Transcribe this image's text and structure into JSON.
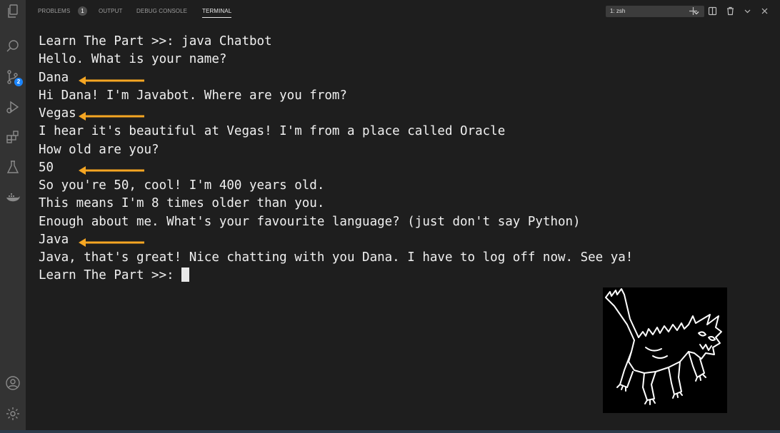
{
  "panel": {
    "tabs": [
      {
        "label": "PROBLEMS",
        "badge": "1"
      },
      {
        "label": "OUTPUT"
      },
      {
        "label": "DEBUG CONSOLE"
      },
      {
        "label": "TERMINAL",
        "active": true
      }
    ],
    "terminal_selector": "1: zsh"
  },
  "activity_bar": {
    "source_control_badge": "2",
    "icons": [
      "explorer-icon",
      "search-icon",
      "source-control-icon",
      "run-debug-icon",
      "extensions-icon",
      "testing-icon",
      "docker-icon",
      "account-icon",
      "settings-gear-icon"
    ]
  },
  "terminal": {
    "lines": [
      "Learn The Part >>: java Chatbot",
      "Hello. What is your name?",
      "Dana",
      "Hi Dana! I'm Javabot. Where are you from?",
      "Vegas",
      "I hear it's beautiful at Vegas! I'm from a place called Oracle",
      "How old are you?",
      "50",
      "So you're 50, cool! I'm 400 years old.",
      "This means I'm 8 times older than you.",
      "Enough about me. What's your favourite language? (just don't say Python)",
      "Java",
      "Java, that's great! Nice chatting with you Dana. I have to log off now. See ya!",
      "Learn The Part >>: "
    ]
  },
  "colors": {
    "arrow": "#f5a623",
    "terminal_bg": "#1e1e1e",
    "activity_bg": "#333333",
    "badge": "#1a85ff"
  }
}
